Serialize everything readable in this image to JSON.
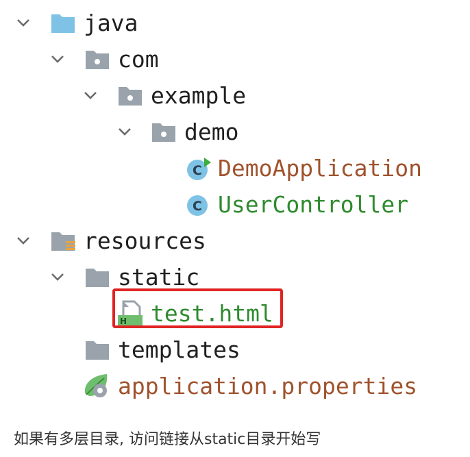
{
  "tree": {
    "java": "java",
    "com": "com",
    "example": "example",
    "demo": "demo",
    "demo_application": "DemoApplication",
    "user_controller": "UserController",
    "resources": "resources",
    "static": "static",
    "test_html": "test.html",
    "templates": "templates",
    "application_properties": "application.properties",
    "class_badge": "C",
    "html_badge": "H"
  },
  "caption": "如果有多层目录, 访问链接从static目录开始写",
  "colors": {
    "accent_orange": "#a0522d",
    "accent_green": "#2e8b2e",
    "folder_blue": "#7ec3e6",
    "folder_gray": "#9aa3ab",
    "highlight_red": "#e02424"
  }
}
